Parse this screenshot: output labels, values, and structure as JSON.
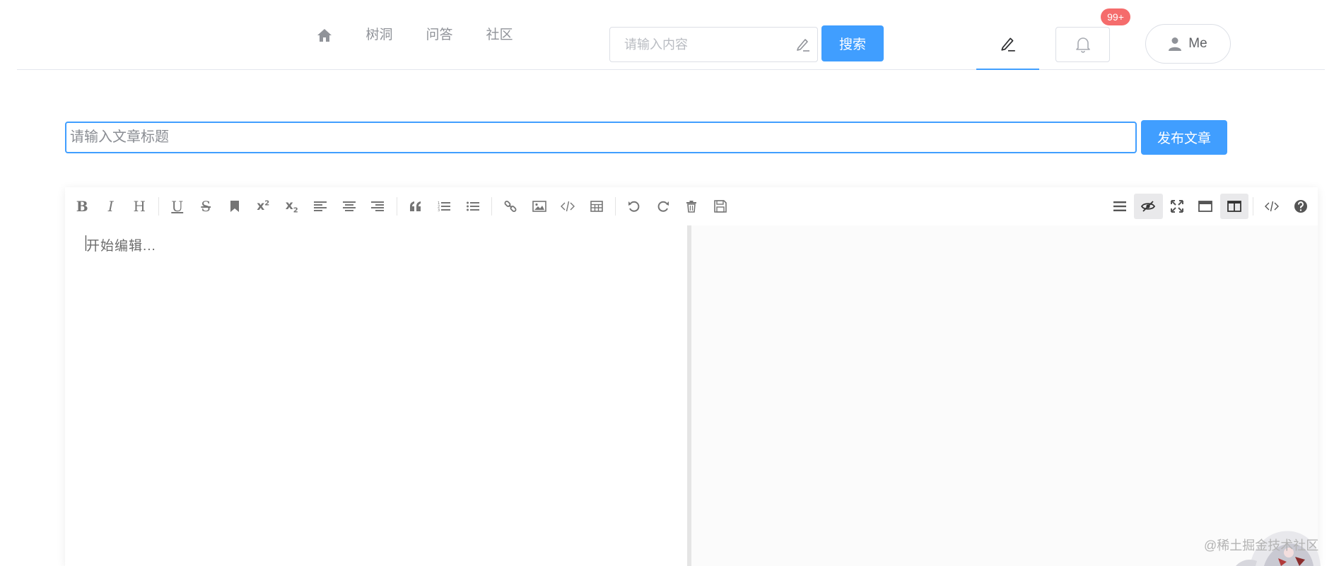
{
  "header": {
    "nav_items": [
      {
        "label": "树洞"
      },
      {
        "label": "问答"
      },
      {
        "label": "社区"
      }
    ],
    "search": {
      "placeholder": "请输入内容",
      "button_label": "搜索"
    },
    "notification_badge": "99+",
    "user_label": "Me"
  },
  "editor_page": {
    "title_placeholder": "请输入文章标题",
    "publish_label": "发布文章",
    "content_placeholder": "开始编辑..."
  },
  "toolbar": {
    "left_icons": [
      "bold-icon",
      "italic-icon",
      "header-icon",
      "underline-icon",
      "strikethrough-icon",
      "mark-icon",
      "superscript-icon",
      "subscript-icon",
      "align-left-icon",
      "align-center-icon",
      "align-right-icon",
      "quote-icon",
      "ordered-list-icon",
      "unordered-list-icon",
      "link-icon",
      "image-icon",
      "code-icon",
      "table-icon",
      "undo-icon",
      "redo-icon",
      "trash-icon",
      "save-icon"
    ],
    "right_icons": [
      "navigation-icon",
      "preview-toggle-icon",
      "fullscreen-icon",
      "read-mode-icon",
      "subfield-icon",
      "html-code-icon",
      "help-icon"
    ]
  },
  "watermark": "@稀土掘金技术社区",
  "colors": {
    "primary": "#409eff",
    "badge": "#f56c6c",
    "border": "#dcdfe6",
    "muted_text": "#909399"
  }
}
